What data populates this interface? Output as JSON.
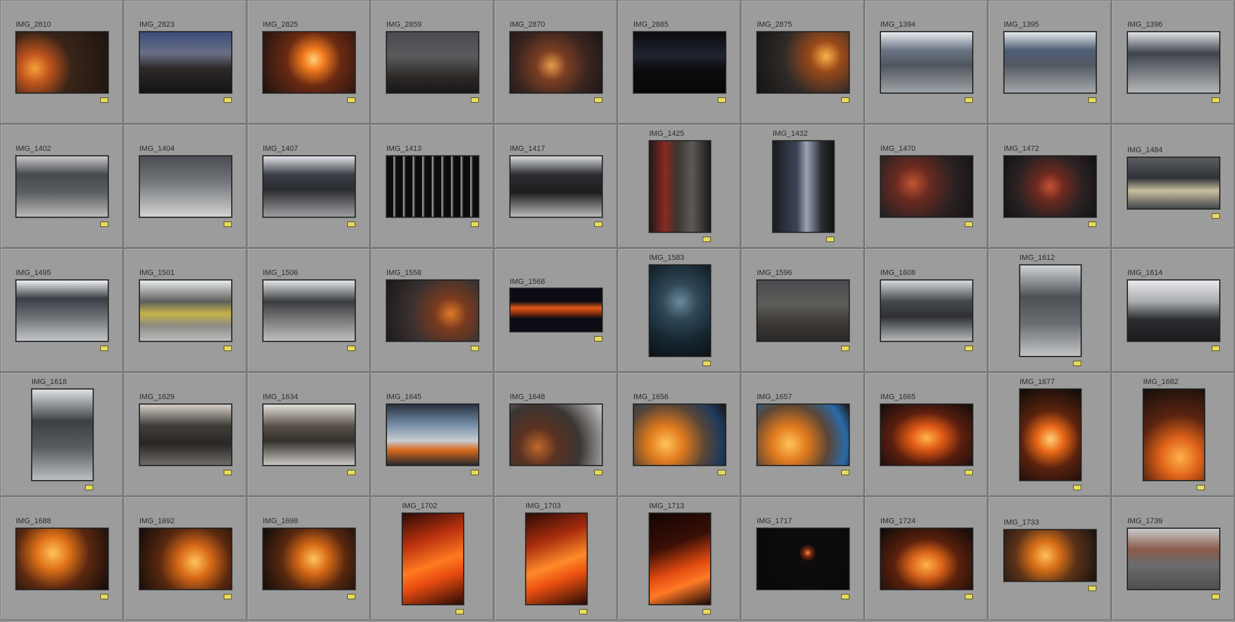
{
  "cells": [
    {
      "label": "IMG_2810",
      "orient": "L",
      "bg": "radial-gradient(circle at 20% 60%, #f6a03a 0%, #c0551e 18%, #3a2418 45%, #1d1410 100%)"
    },
    {
      "label": "IMG_2823",
      "orient": "L",
      "bg": "linear-gradient(180deg,#3b4e78 0%,#6b6f85 35%,#2e2a2a 60%,#141212 100%)"
    },
    {
      "label": "IMG_2825",
      "orient": "L",
      "bg": "radial-gradient(circle at 55% 45%, #ffd27a 0%, #f07a1e 18%, #6a2a12 45%, #1d1210 100%)"
    },
    {
      "label": "IMG_2859",
      "orient": "L",
      "bg": "linear-gradient(180deg,#4a4a52 0%,#5b5a5c 40%,#2b2826 75%,#1a1818 100%)"
    },
    {
      "label": "IMG_2870",
      "orient": "L",
      "bg": "radial-gradient(circle at 45% 55%, #e89a4a 0%, #7a3e22 25%, #3a2520 60%, #1c1616 100%)"
    },
    {
      "label": "IMG_2885",
      "orient": "L",
      "bg": "linear-gradient(180deg,#0b0b0f 0%,#1f2430 40%,#0d0d10 60%,#060607 100%)"
    },
    {
      "label": "IMG_2875",
      "orient": "L",
      "bg": "radial-gradient(circle at 75% 40%, #ffb14a 0%, #9a4a1a 20%, #2e2a28 55%, #151413 100%)"
    },
    {
      "label": "IMG_1394",
      "orient": "L",
      "bg": "linear-gradient(180deg,#e8ecef 0%,#6a7484 30%,#50565e 55%,#9da2a6 100%)"
    },
    {
      "label": "IMG_1395",
      "orient": "L",
      "bg": "linear-gradient(180deg,#e6eaee 0%,#4e5d74 30%,#545a62 55%,#a3a7ab 100%)"
    },
    {
      "label": "IMG_1396",
      "orient": "L",
      "bg": "linear-gradient(180deg,#dfe3e6 0%,#3f444b 35%,#6c7176 60%,#b3b6b8 100%)"
    },
    {
      "label": "IMG_1402",
      "orient": "L",
      "bg": "linear-gradient(180deg,#c8c9cb 0%,#46494d 30%,#5b5e61 60%,#b9babb 100%)"
    },
    {
      "label": "IMG_1404",
      "orient": "L",
      "bg": "linear-gradient(180deg,#4a4d52 0%,#707378 40%,#a8aaac 75%,#d2d3d4 100%)"
    },
    {
      "label": "IMG_1407",
      "orient": "L",
      "bg": "linear-gradient(180deg,#dfe3e7 0%,#3c4047 30%,#2a2c30 55%,#9b9da0 100%)"
    },
    {
      "label": "IMG_1413",
      "orient": "L",
      "bg": "repeating-linear-gradient(90deg,#0c0c0d 0px,#0c0c0d 9px,#bfc3c6 10px,#3a3d40 12px,#0c0c0d 14px)"
    },
    {
      "label": "IMG_1417",
      "orient": "L",
      "bg": "linear-gradient(180deg,#d9dcdf 0%,#2c2e31 30%,#1c1d1f 60%,#b8babc 100%)"
    },
    {
      "label": "IMG_1425",
      "orient": "P",
      "bg": "linear-gradient(90deg,#1d1a1a 0%,#8a2a22 25%,#3d3330 45%,#5c5a58 70%,#1d1b1b 100%)"
    },
    {
      "label": "IMG_1432",
      "orient": "P",
      "bg": "linear-gradient(90deg,#1a1c22 0%,#3d4556 40%,#9aa4b5 55%,#2a2c32 80%,#121314 100%)"
    },
    {
      "label": "IMG_1470",
      "orient": "L",
      "bg": "radial-gradient(circle at 35% 45%, #c25533 0%, #6a2a20 25%, #2c2222 60%, #141213 100%)"
    },
    {
      "label": "IMG_1472",
      "orient": "L",
      "bg": "radial-gradient(circle at 50% 50%, #c65233 0%, #6d2920 25%, #2b2223 60%, #131213 100%)"
    },
    {
      "label": "IMG_1484",
      "orient": "L2",
      "bg": "linear-gradient(180deg,#5a5e63 0%,#2e3135 40%,#c9c0a0 65%,#44474b 100%)"
    },
    {
      "label": "IMG_1495",
      "orient": "L",
      "bg": "linear-gradient(180deg,#eef0f2 0%,#3a3e44 30%,#6c7075 60%,#c2c5c8 100%)"
    },
    {
      "label": "IMG_1501",
      "orient": "L",
      "bg": "linear-gradient(180deg,#e9ecee 0%,#5d5f5c 35%,#c6b24a 55%,#8b8a84 75%,#bcbdbd 100%)"
    },
    {
      "label": "IMG_1506",
      "orient": "L",
      "bg": "linear-gradient(180deg,#e3e6e9 0%,#3b3d40 35%,#6e6f71 60%,#bdbebf 100%)"
    },
    {
      "label": "IMG_1558",
      "orient": "L",
      "bg": "radial-gradient(circle at 70% 55%, #e07a2a 0%, #7a3a1e 22%, #3a3230 55%, #1a1818 100%)"
    },
    {
      "label": "IMG_1568",
      "orient": "W",
      "bg": "linear-gradient(180deg,#0c0d14 0%,#0c0d14 30%,#e05a18 45%,#a3360f 55%,#0c0d14 70%,#0c0d14 100%)"
    },
    {
      "label": "IMG_1583",
      "orient": "P",
      "bg": "radial-gradient(circle at 50% 40%, #6a8a9a 0%, #2e4656 30%, #162630 65%, #0b1216 100%)"
    },
    {
      "label": "IMG_1596",
      "orient": "L",
      "bg": "linear-gradient(180deg,#4a4c4f 0%,#5e5c58 40%,#3c3936 70%,#2a2826 100%)"
    },
    {
      "label": "IMG_1608",
      "orient": "L",
      "bg": "linear-gradient(180deg,#d7dadd 0%,#44474b 35%,#2e3034 60%,#b5b8ba 100%)"
    },
    {
      "label": "IMG_1612",
      "orient": "P",
      "bg": "linear-gradient(180deg,#cfd3d6 0%,#4d5156 35%,#6b6f73 65%,#c2c4c6 100%)"
    },
    {
      "label": "IMG_1614",
      "orient": "L",
      "bg": "linear-gradient(180deg,#e7e9eb 0%,#a9acaf 35%,#2a2c2f 65%,#1b1c1e 100%)"
    },
    {
      "label": "IMG_1618",
      "orient": "P",
      "bg": "linear-gradient(180deg,#dfe2e5 0%,#3c4044 35%,#5a5e62 65%,#bcbfc1 100%)"
    },
    {
      "label": "IMG_1629",
      "orient": "L",
      "bg": "linear-gradient(180deg,#d5d0c8 0%,#403c38 35%,#2a2624 65%,#6e6a66 100%)"
    },
    {
      "label": "IMG_1634",
      "orient": "L",
      "bg": "linear-gradient(180deg,#e3e0d9 0%,#5a534c 35%,#332f2b 60%,#c9c6c1 100%)"
    },
    {
      "label": "IMG_1645",
      "orient": "L",
      "bg": "linear-gradient(180deg,#2a3340 0%,#6c85a0 30%,#c7cdd2 60%,#d96a1e 75%,#2a2a2c 100%)"
    },
    {
      "label": "IMG_1648",
      "orient": "L",
      "bg": "radial-gradient(circle at 30% 70%, #c0662a 0%, #5a3222 25%, #3a3532 55%, #c8c9ca 100%)"
    },
    {
      "label": "IMG_1656",
      "orient": "L",
      "bg": "radial-gradient(circle at 35% 65%, #ffc45a 0%, #e07a1e 25%, #5a4636 55%, #1e3a5c 80%, #1a1616 100%)"
    },
    {
      "label": "IMG_1657",
      "orient": "L",
      "bg": "radial-gradient(circle at 35% 65%, #ffc45a 0%, #e07a1e 25%, #5a4636 55%, #2a6aa8 80%, #1a1616 100%)"
    },
    {
      "label": "IMG_1665",
      "orient": "L",
      "bg": "radial-gradient(ellipse at 50% 55%, #ffb44a 0%, #e05a16 25%, #5a1e0e 55%, #120d0c 100%)"
    },
    {
      "label": "IMG_1677",
      "orient": "P",
      "bg": "radial-gradient(circle at 50% 55%, #ffd27a 0%, #ea6a18 22%, #5a220e 50%, #0f0b0a 100%)"
    },
    {
      "label": "IMG_1682",
      "orient": "P",
      "bg": "radial-gradient(circle at 60% 75%, #ffb04a 0%, #e0641a 25%, #5a2410 55%, #140e0c 100%)"
    },
    {
      "label": "IMG_1688",
      "orient": "L",
      "bg": "radial-gradient(circle at 40% 40%, #ffc45a 0%, #e07218 25%, #5a2810 55%, #110c0a 100%)"
    },
    {
      "label": "IMG_1692",
      "orient": "L",
      "bg": "radial-gradient(circle at 60% 55%, #ffc45a 0%, #d86a18 25%, #58280f 55%, #110c0a 100%)"
    },
    {
      "label": "IMG_1698",
      "orient": "L",
      "bg": "radial-gradient(circle at 55% 50%, #ffc45a 0%, #d86a18 25%, #58280f 55%, #110c0a 100%)"
    },
    {
      "label": "IMG_1702",
      "orient": "P",
      "bg": "linear-gradient(160deg,#2a0c06 0%,#b8300e 30%,#ff7a20 55%,#e84a10 70%,#2a0c06 100%)"
    },
    {
      "label": "IMG_1703",
      "orient": "P",
      "bg": "linear-gradient(160deg,#2a0c06 0%,#a82c0e 30%,#ff8a2a 55%,#ec5010 70%,#2a0c06 100%)"
    },
    {
      "label": "IMG_1713",
      "orient": "P",
      "bg": "linear-gradient(160deg,#120604 0%,#3a0e06 35%,#e24a10 60%,#ff7a26 75%,#1a0806 100%)"
    },
    {
      "label": "IMG_1717",
      "orient": "L",
      "bg": "radial-gradient(circle at 55% 40%, #ff8a3a 0%, #7a2a10 6%, #0d0b0b 14%, #0a0a0a 100%)"
    },
    {
      "label": "IMG_1724",
      "orient": "L",
      "bg": "radial-gradient(ellipse at 50% 60%, #ffb04a 0%, #d8641a 25%, #5a200c 50%, #0e0a09 100%)"
    },
    {
      "label": "IMG_1733",
      "orient": "L2",
      "bg": "radial-gradient(circle at 45% 50%, #ffc05a 0%, #d87018 25%, #5a3218 55%, #1a1410 100%)"
    },
    {
      "label": "IMG_1739",
      "orient": "L",
      "bg": "linear-gradient(180deg,#c7c9cb 0%,#8a5a4a 35%,#6a6c6e 60%,#4c4e50 100%)"
    }
  ]
}
